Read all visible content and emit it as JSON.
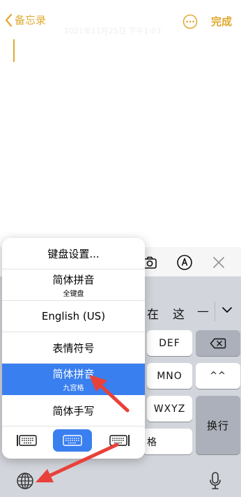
{
  "nav": {
    "back_label": "备忘录",
    "date_text": "2021年11月25日 下午1:03",
    "done_label": "完成"
  },
  "toolbar": {
    "icons": [
      "camera-icon",
      "markup-pen-icon",
      "close-icon"
    ]
  },
  "candidates": [
    "在",
    "这",
    "—"
  ],
  "keys": {
    "def": "DEF",
    "mno": "MNO",
    "caret_face": "^^",
    "wxyz": "WXYZ",
    "return": "换行",
    "partial": "格"
  },
  "menu": {
    "items": [
      {
        "label": "键盘设置..."
      },
      {
        "label": "简体拼音",
        "sub": "全键盘"
      },
      {
        "label": "English (US)"
      },
      {
        "label": "表情符号"
      },
      {
        "label": "简体拼音",
        "sub": "九宫格",
        "selected": true
      },
      {
        "label": "简体手写"
      }
    ],
    "modes": [
      "keyboard-left-icon",
      "keyboard-full-icon",
      "keyboard-right-icon"
    ]
  },
  "colors": {
    "accent": "#e0a82e",
    "selected": "#3a7ff0",
    "arrow": "#e8413a",
    "keyboard_bg": "#d2d5db"
  }
}
